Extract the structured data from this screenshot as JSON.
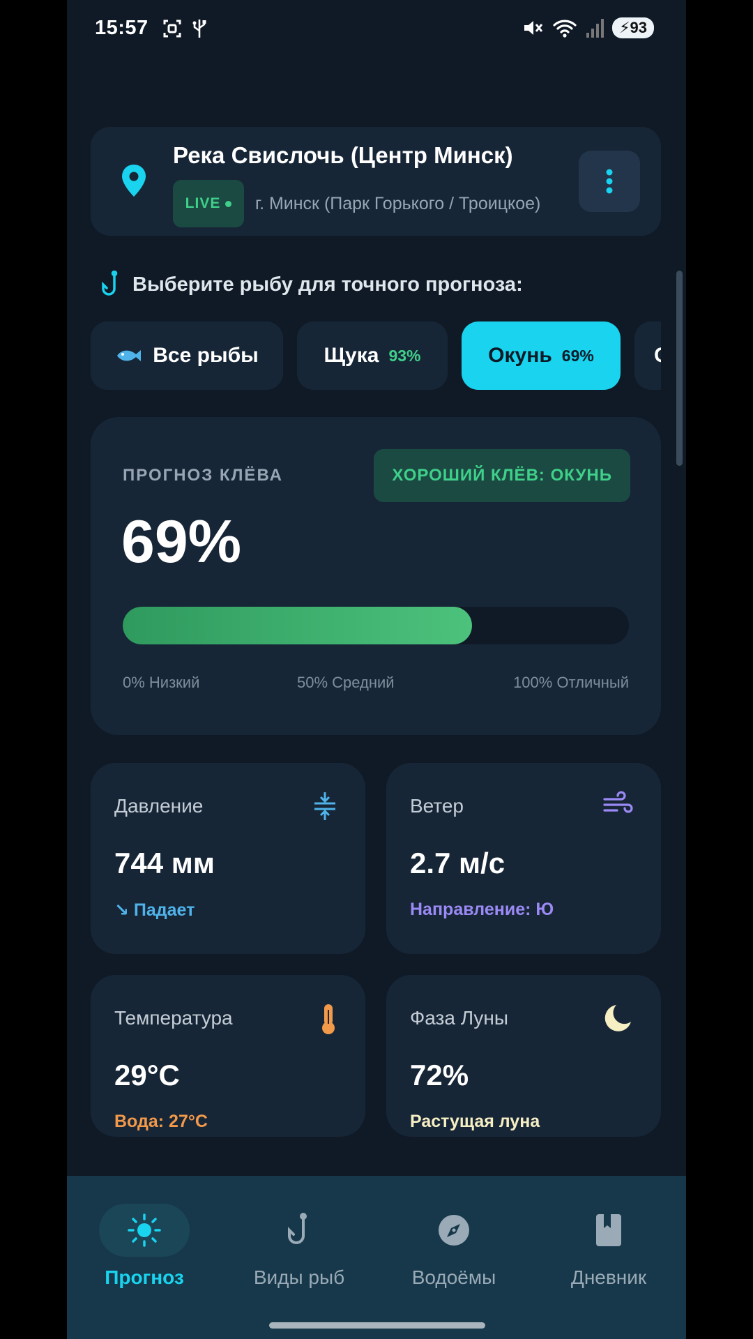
{
  "status_bar": {
    "time": "15:57",
    "battery": "93"
  },
  "location": {
    "title": "Река Свислочь (Центр Минск)",
    "live": "LIVE",
    "subtitle": "г. Минск (Парк Горького / Троицкое)"
  },
  "fish_select": {
    "heading": "Выберите рыбу для точного прогноза:",
    "chips": [
      {
        "label": "Все рыбы",
        "pct": ""
      },
      {
        "label": "Щука",
        "pct": "93%"
      },
      {
        "label": "Окунь",
        "pct": "69%",
        "active": true
      },
      {
        "label": "С",
        "pct": ""
      }
    ]
  },
  "forecast": {
    "label": "ПРОГНОЗ КЛЁВА",
    "badge": "ХОРОШИЙ КЛЁВ: ОКУНЬ",
    "value": "69%",
    "progress": 0.69,
    "scale_low": "0% Низкий",
    "scale_mid": "50% Средний",
    "scale_high": "100% Отличный"
  },
  "metrics": {
    "pressure": {
      "title": "Давление",
      "value": "744 мм",
      "sub": "↘ Падает",
      "color": "#4fb3ea"
    },
    "wind": {
      "title": "Ветер",
      "value": "2.7 м/с",
      "sub": "Направление: Ю",
      "color": "#9b8af5"
    },
    "temperature": {
      "title": "Температура",
      "value": "29°C",
      "sub": "Вода: 27°C",
      "color": "#f2994a"
    },
    "moon": {
      "title": "Фаза Луны",
      "value": "72%",
      "sub": "Растущая луна",
      "color": "#f6efc4"
    }
  },
  "nav": {
    "forecast": "Прогноз",
    "fish": "Виды рыб",
    "waters": "Водоёмы",
    "diary": "Дневник"
  },
  "colors": {
    "accent": "#19d3ef",
    "good": "#3fd08a",
    "card": "#172637",
    "bg": "#0f1a26"
  }
}
